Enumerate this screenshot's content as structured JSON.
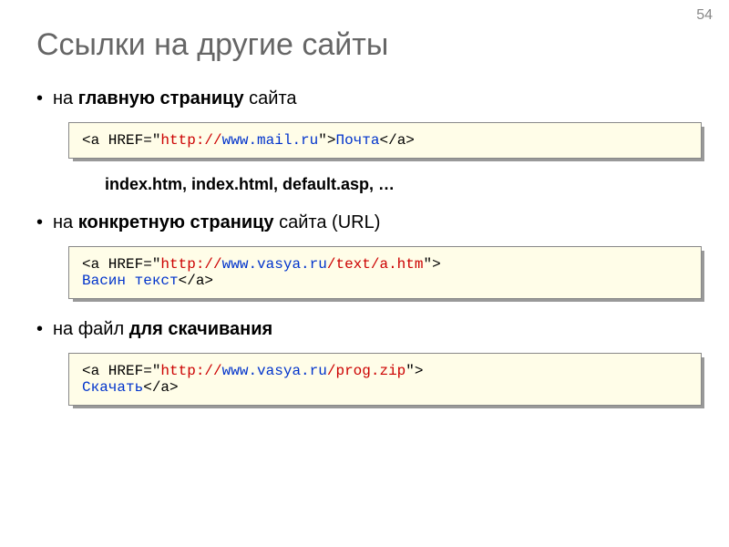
{
  "pageNumber": "54",
  "title": "Ссылки на другие сайты",
  "sections": [
    {
      "bullet": {
        "prefix": "на ",
        "bold": "главную страницу",
        "suffix": " сайта"
      },
      "code": {
        "tag_open": "<a",
        "href_label": " HREF=\"",
        "protocol": "http://",
        "url": "www.mail.ru",
        "close_attr": "\">",
        "link_text": "Почта",
        "tag_close": "</a>"
      },
      "note": "index.htm, index.html, default.asp, …"
    },
    {
      "bullet": {
        "prefix": "на ",
        "bold": "конкретную страницу",
        "suffix": " сайта (URL)"
      },
      "code": {
        "tag_open": "<a",
        "href_label": " HREF=\"",
        "protocol": "http://",
        "url": "www.vasya.ru",
        "path": "/text/a.htm",
        "close_attr": "\">",
        "br": true,
        "link_text": "Васин текст",
        "tag_close": "</a>"
      }
    },
    {
      "bullet": {
        "prefix": "на файл ",
        "bold": "для скачивания",
        "suffix": ""
      },
      "code": {
        "tag_open": "<a",
        "href_label": " HREF=\"",
        "protocol": "http://",
        "url": "www.vasya.ru",
        "path": "/prog.zip",
        "close_attr": "\">",
        "br": true,
        "link_text": "Скачать",
        "tag_close": "</a>"
      }
    }
  ]
}
